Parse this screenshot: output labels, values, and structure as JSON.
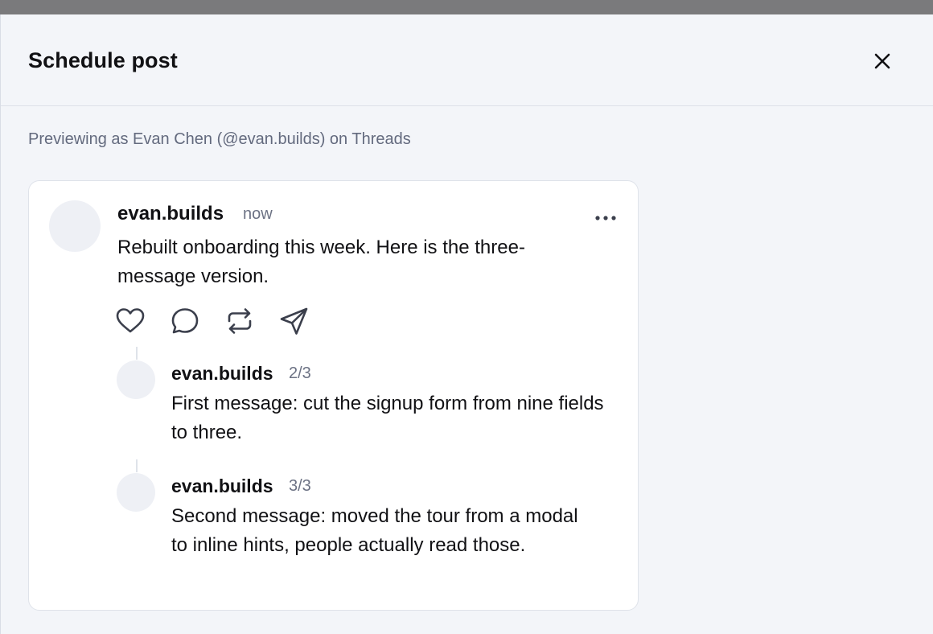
{
  "modal": {
    "title": "Schedule post",
    "close_icon": "close-icon"
  },
  "preview": {
    "label": "Previewing as Evan Chen (@evan.builds) on Threads"
  },
  "post": {
    "username": "evan.builds",
    "time": "now",
    "text": "Rebuilt onboarding this week. Here is the three-message version.",
    "more_icon": "more-horizontal-icon",
    "actions": [
      "heart-icon",
      "comment-icon",
      "repost-icon",
      "share-icon"
    ]
  },
  "replies": [
    {
      "username": "evan.builds",
      "counter": "2/3",
      "text": "First message: cut the signup form from nine fields to three."
    },
    {
      "username": "evan.builds",
      "counter": "3/3",
      "text": "Second message: moved the tour from a modal to inline hints, people actually read those."
    }
  ],
  "colors": {
    "backdrop": "#7a7a7c",
    "modal_bg": "#f3f5f9",
    "card_bg": "#ffffff",
    "muted_text": "#636a7e",
    "avatar_bg": "#eef0f5"
  }
}
